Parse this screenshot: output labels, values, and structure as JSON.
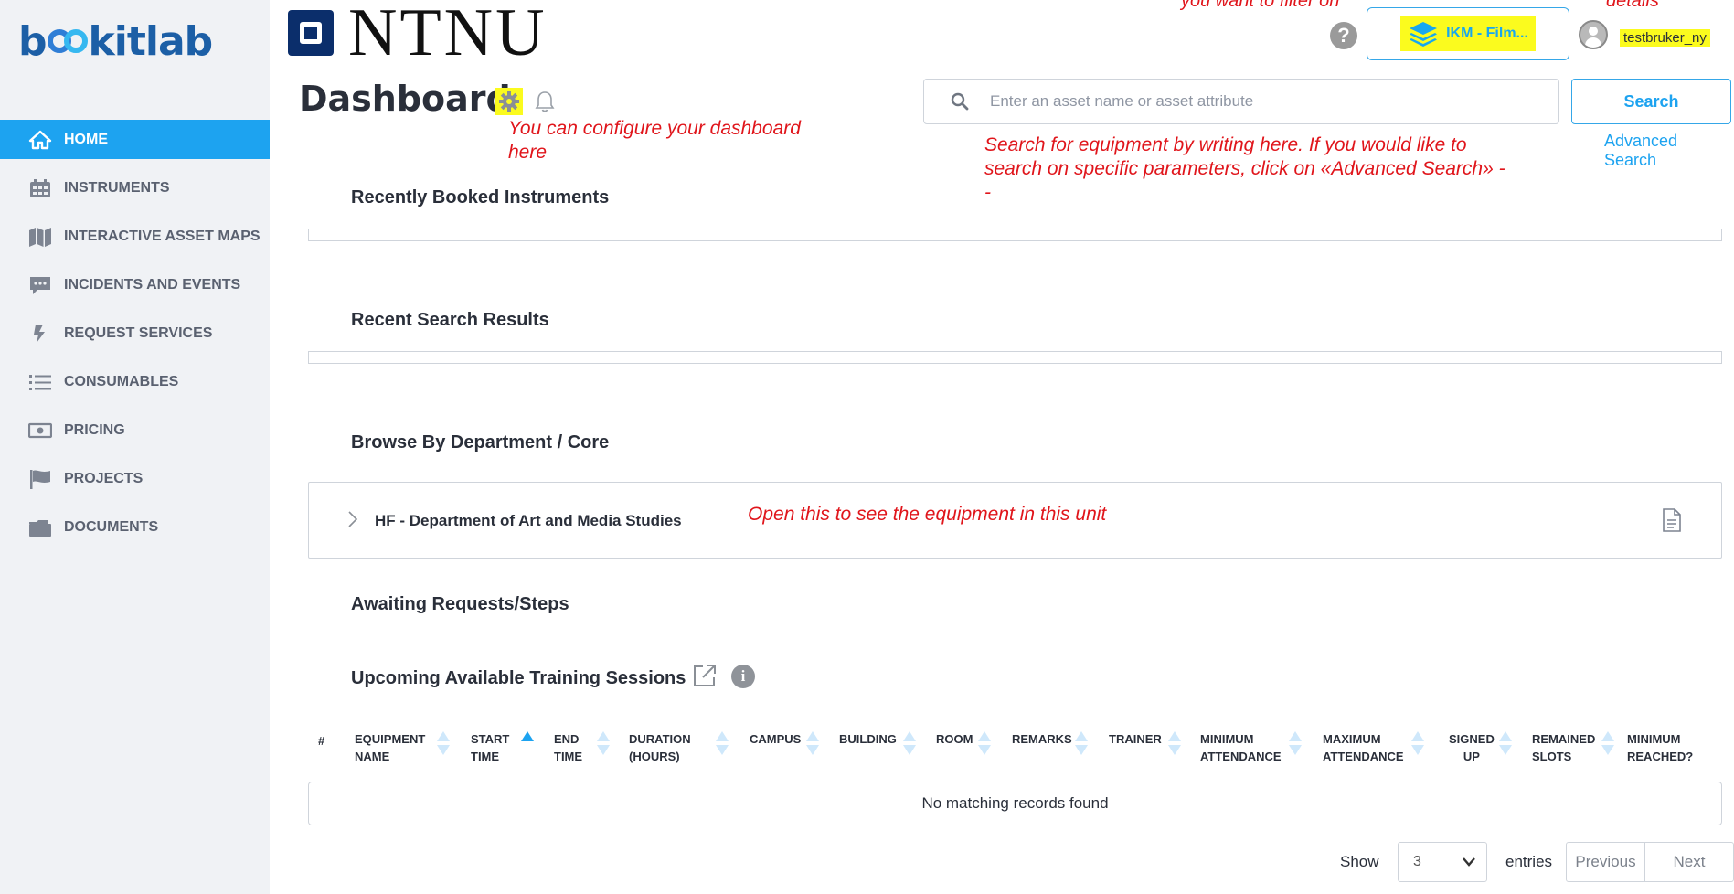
{
  "brand": {
    "logo_text_left": "b",
    "logo_text_right": "kitlab",
    "institution": "NTNU"
  },
  "header": {
    "help_glyph": "?",
    "filter_label": "IKM - Film...",
    "username": "testbruker_ny",
    "note_filter": "you want to filter on",
    "note_user": "details"
  },
  "sidebar": {
    "items": [
      {
        "label": "HOME",
        "icon": "home-icon",
        "active": true
      },
      {
        "label": "INSTRUMENTS",
        "icon": "calendar-icon"
      },
      {
        "label": "INTERACTIVE ASSET MAPS",
        "icon": "map-icon"
      },
      {
        "label": "INCIDENTS AND EVENTS",
        "icon": "chat-icon"
      },
      {
        "label": "REQUEST SERVICES",
        "icon": "bolt-icon"
      },
      {
        "label": "CONSUMABLES",
        "icon": "list-icon"
      },
      {
        "label": "PRICING",
        "icon": "money-icon"
      },
      {
        "label": "PROJECTS",
        "icon": "flag-icon"
      },
      {
        "label": "DOCUMENTS",
        "icon": "folder-icon"
      }
    ]
  },
  "page": {
    "title": "Dashboard",
    "note_configure_1": "You can configure your dashboard",
    "note_configure_2": "here",
    "note_search_1": "Search for equipment by writing here. If you  would like to",
    "note_search_2": "search on specific parameters, click on «Advanced Search» -",
    "note_search_3": "-",
    "note_unit": "Open this to see the equipment in this unit"
  },
  "search": {
    "placeholder": "Enter an asset name or asset attribute",
    "button": "Search",
    "advanced": "Advanced Search"
  },
  "sections": {
    "recently_booked": "Recently Booked Instruments",
    "recent_search": "Recent Search Results",
    "browse": "Browse By Department / Core",
    "department": "HF - Department of Art and Media Studies",
    "awaiting": "Awaiting Requests/Steps",
    "training": "Upcoming Available Training Sessions"
  },
  "table": {
    "columns": [
      {
        "l1": "#",
        "l2": ""
      },
      {
        "l1": "EQUIPMENT",
        "l2": "NAME"
      },
      {
        "l1": "START",
        "l2": "TIME"
      },
      {
        "l1": "END",
        "l2": "TIME"
      },
      {
        "l1": "DURATION",
        "l2": "(HOURS)"
      },
      {
        "l1": "CAMPUS",
        "l2": ""
      },
      {
        "l1": "BUILDING",
        "l2": ""
      },
      {
        "l1": "ROOM",
        "l2": ""
      },
      {
        "l1": "REMARKS",
        "l2": ""
      },
      {
        "l1": "TRAINER",
        "l2": ""
      },
      {
        "l1": "MINIMUM",
        "l2": "ATTENDANCE"
      },
      {
        "l1": "MAXIMUM",
        "l2": "ATTENDANCE"
      },
      {
        "l1": "SIGNED",
        "l2": "UP"
      },
      {
        "l1": "REMAINED",
        "l2": "SLOTS"
      },
      {
        "l1": "MINIMUM",
        "l2": "REACHED?"
      }
    ],
    "empty_message": "No matching records found",
    "sorted_column": "START TIME",
    "sort_direction": "ascending"
  },
  "pagination": {
    "show": "Show",
    "page_size": "3",
    "entries": "entries",
    "previous": "Previous",
    "next": "Next"
  },
  "colors": {
    "accent": "#1da3f0",
    "highlight": "#fbfb1e",
    "annotation": "#e0151b",
    "sidebar_bg": "#f0f2f5"
  }
}
